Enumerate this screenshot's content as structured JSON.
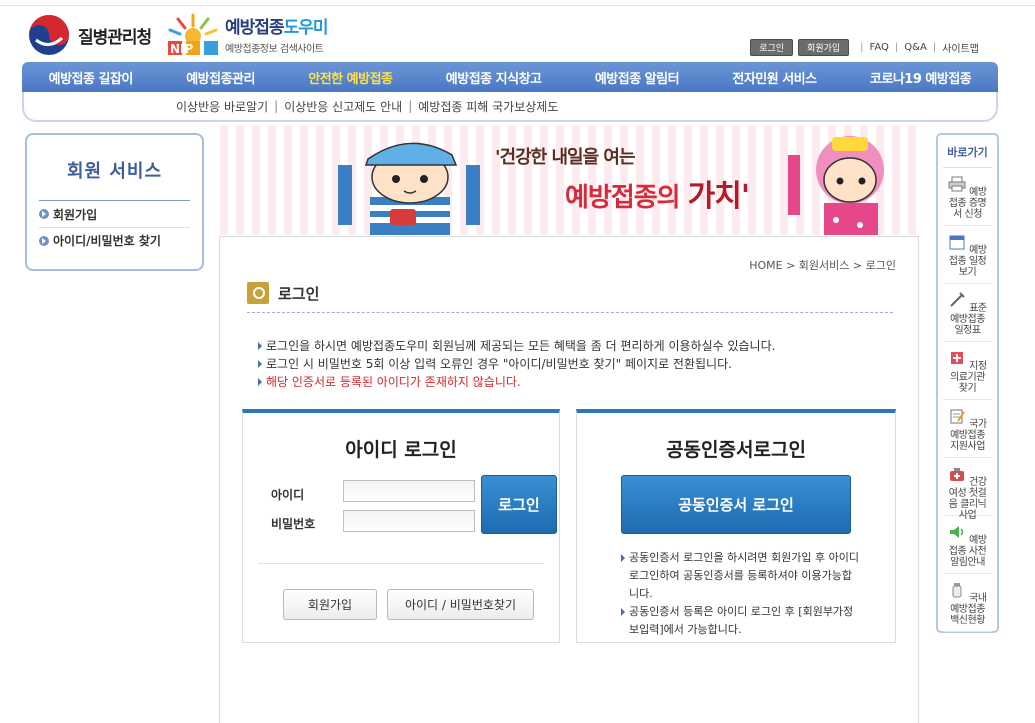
{
  "header": {
    "kdca_name": "질병관리청",
    "nip_badge": "NIP",
    "nip_title_main": "예방접종",
    "nip_title_accent": "도우미",
    "nip_subtitle": "예방접종정보 검색사이트",
    "util": {
      "login": "로그인",
      "join": "회원가입",
      "faq": "FAQ",
      "qna": "Q&A",
      "sitemap": "사이트맵"
    }
  },
  "gnb": [
    {
      "label": "예방접종 길잡이",
      "active": false
    },
    {
      "label": "예방접종관리",
      "active": false
    },
    {
      "label": "안전한 예방접종",
      "active": true
    },
    {
      "label": "예방접종 지식창고",
      "active": false
    },
    {
      "label": "예방접종 알림터",
      "active": false
    },
    {
      "label": "전자민원 서비스",
      "active": false
    },
    {
      "label": "코로나19 예방접종",
      "active": false
    }
  ],
  "subnav": [
    "이상반응 바로알기",
    "이상반응 신고제도 안내",
    "예방접종 피해 국가보상제도"
  ],
  "lnb": {
    "title": "회원 서비스",
    "items": [
      "회원가입",
      "아이디/비밀번호 찾기"
    ]
  },
  "banner": {
    "line1": "'건강한 내일을 여는",
    "line2a": "예방접종의",
    "line2b": "가치'"
  },
  "content": {
    "breadcrumb": [
      "HOME",
      "회원서비스",
      "로그인"
    ],
    "title": "로그인",
    "notices": [
      "로그인을 하시면 예방접종도우미 회원님께 제공되는 모든 혜택을 좀 더 편리하게 이용하실수 있습니다.",
      "로그인 시 비밀번호 5회 이상 입력 오류인 경우 \"아이디/비밀번호 찾기\" 페이지로 전환됩니다."
    ],
    "warning": "해당 인증서로 등록된 아이디가 존재하지 않습니다.",
    "id_login": {
      "title": "아이디 로그인",
      "id_label": "아이디",
      "id_value": "",
      "pw_label": "비밀번호",
      "pw_value": "",
      "login_button": "로그인",
      "join_button": "회원가입",
      "find_button": "아이디 / 비밀번호찾기"
    },
    "cert_login": {
      "title": "공동인증서로그인",
      "button": "공동인증서 로그인",
      "notes": [
        "공동인증서 로그인을 하시려면 회원가입 후 아이디 로그인하여 공동인증서를 등록하셔야 이용가능합니다.",
        "공동인증서 등록은 아이디 로그인 후 [회원부가정보입력]에서 가능합니다."
      ]
    }
  },
  "quick": {
    "title": "바로가기",
    "items": [
      {
        "label": "예방접종 증명서 신청",
        "icon": "printer-icon"
      },
      {
        "label": "예방접종 일정보기",
        "icon": "calendar-icon"
      },
      {
        "label": "표준예방접종 일정표",
        "icon": "syringe-icon"
      },
      {
        "label": "지정의료기관 찾기",
        "icon": "hospital-icon"
      },
      {
        "label": "국가예방접종 지원사업",
        "icon": "memo-icon"
      },
      {
        "label": "건강여성 첫걸음 클리닉사업",
        "icon": "medkit-icon"
      },
      {
        "label": "예방접종 사전알림안내",
        "icon": "speaker-icon"
      },
      {
        "label": "국내예방접종 백신현황",
        "icon": "vial-icon"
      }
    ]
  },
  "colors": {
    "gnb": "#4a78c4",
    "active_menu": "#ffe14a",
    "button_blue": "#1e6bb0",
    "warning": "#d2282e"
  }
}
